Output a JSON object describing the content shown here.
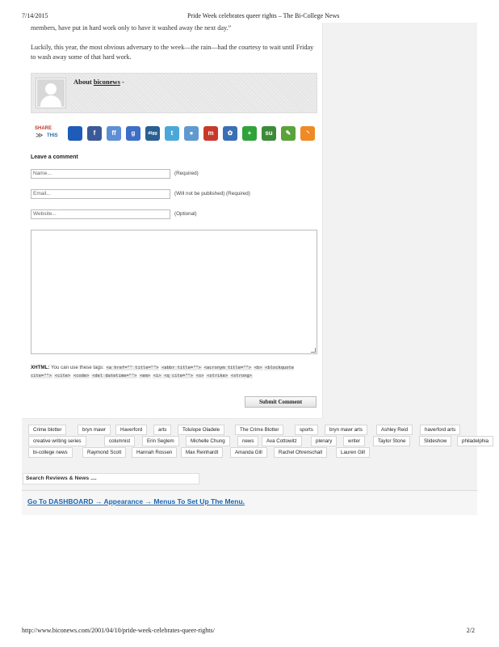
{
  "header": {
    "date": "7/14/2015",
    "title": "Pride Week celebrates queer rights – The Bi-College News"
  },
  "article": {
    "para1": "members, have put in hard work only to have it washed away the next day.”",
    "para2": "Luckily, this year, the most obvious adversary to the week—the rain—had the courtesy to wait until Friday to wash away some of that hard work."
  },
  "about": {
    "prefix": "About",
    "author": "biconews",
    "suffix": " -"
  },
  "share": {
    "logo_top": "SHARE",
    "logo_bottom": "THIS",
    "icons": [
      {
        "name": "delicious-icon",
        "glyph": "",
        "color": "#1f5bb8"
      },
      {
        "name": "facebook-icon",
        "glyph": "f",
        "color": "#3b5998"
      },
      {
        "name": "friendfeed-icon",
        "glyph": "ff",
        "color": "#5d8fd7"
      },
      {
        "name": "google-icon",
        "glyph": "g",
        "color": "#3d6fc6"
      },
      {
        "name": "digg-icon",
        "glyph": "digg",
        "color": "#2a5f92"
      },
      {
        "name": "twitter-icon",
        "glyph": "t",
        "color": "#4aa8d8"
      },
      {
        "name": "reddit-icon",
        "glyph": "●",
        "color": "#5f99cf"
      },
      {
        "name": "mixx-icon",
        "glyph": "m",
        "color": "#c8392b"
      },
      {
        "name": "myspace-icon",
        "glyph": "✿",
        "color": "#3a6fb4"
      },
      {
        "name": "google-buzz-icon",
        "glyph": "+",
        "color": "#2fa33a"
      },
      {
        "name": "stumbleupon-icon",
        "glyph": "su",
        "color": "#3c8a3a"
      },
      {
        "name": "chat-icon",
        "glyph": "✎",
        "color": "#5aa33b"
      },
      {
        "name": "rss-icon",
        "glyph": "◝",
        "color": "#f08a24"
      }
    ]
  },
  "comment_form": {
    "heading": "Leave a comment",
    "name_placeholder": "Name...",
    "name_note": "(Required)",
    "email_placeholder": "Email...",
    "email_note": "(Will not be published) (Required)",
    "website_placeholder": "Website...",
    "website_note": "(Optional)",
    "xhtml_label": "XHTML:",
    "xhtml_intro": " You can use these tags: ",
    "xhtml_tags": [
      "<a href=\"\" title=\"\">",
      "<abbr title=\"\">",
      "<acronym title=\"\">",
      "<b>",
      "<blockquote cite=\"\">",
      "<cite>",
      "<code>",
      "<del datetime=\"\">",
      "<em>",
      "<i>",
      "<q cite=\"\">",
      "<s>",
      "<strike>",
      "<strong>"
    ],
    "submit_label": "Submit Comment"
  },
  "tags": {
    "row1": [
      "Crime blotter",
      "bryn mawr",
      "Haverford",
      "arts",
      "Tolulope Oladele",
      "The Crime Blotter",
      "sports",
      "bryn mawr arts",
      "Ashley Reid",
      "haverford arts"
    ],
    "row2": [
      "creative writing series",
      "columnist",
      "Erin Seglem",
      "Michelle Chung",
      "news",
      "Ava Cottowitz",
      "plenary",
      "writer",
      "Taylor Stone",
      "Slideshow",
      "philadelphia"
    ],
    "row3": [
      "bi-college news",
      "Raymond Scott",
      "Hannah Rossen",
      "Max Reinhardt",
      "Amanda Gill",
      "Rachel Ohrenschall",
      "Lauren Gill"
    ]
  },
  "search": {
    "placeholder": "Search Reviews & News ...."
  },
  "menu": {
    "link": "Go To DASHBOARD → Appearance → Menus To Set Up The Menu."
  },
  "footer": {
    "url": "http://www.biconews.com/2001/04/10/pride-week-celebrates-queer-rights/",
    "page": "2/2"
  }
}
